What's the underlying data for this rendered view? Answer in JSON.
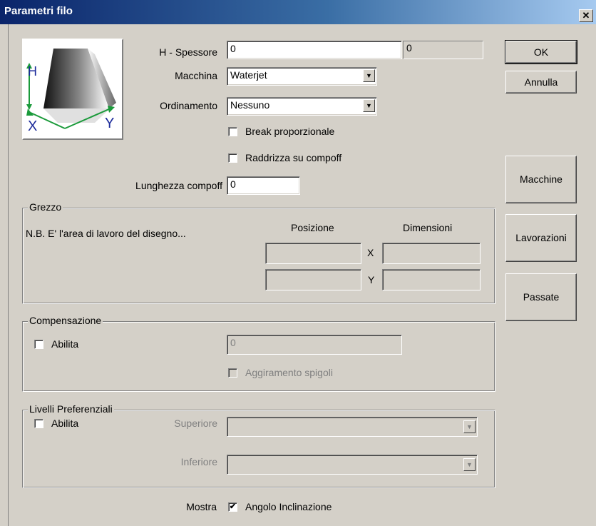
{
  "window": {
    "title": "Parametri filo",
    "close": "✕"
  },
  "diagram": {
    "h_label": "H",
    "x_label": "X",
    "y_label": "Y"
  },
  "fields": {
    "spessore_label": "H - Spessore",
    "spessore_value": "0",
    "spessore_readout": "0",
    "macchina_label": "Macchina",
    "macchina_value": "Waterjet",
    "ordinamento_label": "Ordinamento",
    "ordinamento_value": "Nessuno",
    "break_label": "Break proporzionale",
    "raddrizza_label": "Raddrizza su compoff",
    "lunghezza_label": "Lunghezza compoff",
    "lunghezza_value": "0"
  },
  "grezzo": {
    "title": "Grezzo",
    "note": "N.B. E' l'area di lavoro del disegno...",
    "posizione_label": "Posizione",
    "dimensioni_label": "Dimensioni",
    "x_label": "X",
    "y_label": "Y"
  },
  "compensazione": {
    "title": "Compensazione",
    "abilita_label": "Abilita",
    "value": "0",
    "aggiramento_label": "Aggiramento spigoli"
  },
  "livelli": {
    "title": "Livelli Preferenziali",
    "abilita_label": "Abilita",
    "superiore_label": "Superiore",
    "inferiore_label": "Inferiore"
  },
  "mostra": {
    "label": "Mostra",
    "angolo_label": "Angolo Inclinazione",
    "checked_mark": "✔"
  },
  "buttons": {
    "ok": "OK",
    "annulla": "Annulla",
    "macchine": "Macchine",
    "lavorazioni": "Lavorazioni",
    "passate": "Passate"
  },
  "icons": {
    "dropdown_arrow": "▼"
  }
}
